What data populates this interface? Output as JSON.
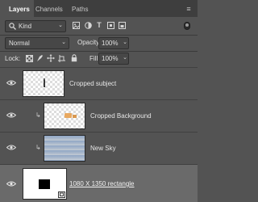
{
  "tabs": [
    {
      "label": "Layers",
      "active": true
    },
    {
      "label": "Channels",
      "active": false
    },
    {
      "label": "Paths",
      "active": false
    }
  ],
  "filter": {
    "kind_label": "Kind"
  },
  "blend": {
    "mode": "Normal",
    "opacity_label": "Opacity:",
    "opacity_value": "100%"
  },
  "lock": {
    "label": "Lock:",
    "fill_label": "Fill:",
    "fill_value": "100%"
  },
  "layers": [
    {
      "name": "Cropped subject",
      "clipped": false,
      "selected": false
    },
    {
      "name": "Cropped Background",
      "clipped": true,
      "selected": false
    },
    {
      "name": "New Sky",
      "clipped": true,
      "selected": false
    },
    {
      "name": "1080 X 1350 rectangle",
      "clipped": false,
      "selected": true
    }
  ],
  "colors": {
    "panel": "#535353",
    "tabbar": "#3e3e3e",
    "selected": "#6a6a6a",
    "sky_top": "#8fa5c4",
    "sky_bottom": "#c3cbd3"
  }
}
